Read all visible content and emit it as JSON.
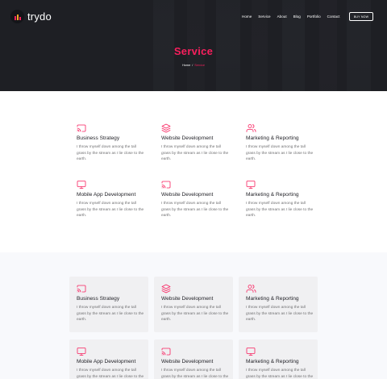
{
  "header": {
    "logo_text": "trydo",
    "nav": [
      "Home",
      "Service",
      "About",
      "Blog",
      "Portfolio",
      "Contact"
    ],
    "buy_now_label": "BUY NOW"
  },
  "hero": {
    "title": "Service",
    "breadcrumb_home": "Home",
    "breadcrumb_separator": "/",
    "breadcrumb_current": "Service"
  },
  "colors": {
    "accent": "#f81f5d",
    "dark": "#1e1f24",
    "text": "#1f1f25",
    "muted": "#717173"
  },
  "services": [
    {
      "icon": "cast-icon",
      "title": "Business Strategy",
      "desc": "I throw myself down among the tall grass by the stream as I lie close to the earth."
    },
    {
      "icon": "layers-icon",
      "title": "Website Development",
      "desc": "I throw myself down among the tall grass by the stream as I lie close to the earth."
    },
    {
      "icon": "users-icon",
      "title": "Marketing & Reporting",
      "desc": "I throw myself down among the tall grass by the stream as I lie close to the earth."
    },
    {
      "icon": "monitor-icon",
      "title": "Mobile App Development",
      "desc": "I throw myself down among the tall grass by the stream as I lie close to the earth."
    },
    {
      "icon": "cast-icon",
      "title": "Website Development",
      "desc": "I throw myself down among the tall grass by the stream as I lie close to the earth."
    },
    {
      "icon": "monitor-icon",
      "title": "Marketing & Reporting",
      "desc": "I throw myself down among the tall grass by the stream as I lie close to the earth."
    }
  ],
  "service_boxes": [
    {
      "icon": "cast-icon",
      "title": "Business Strategy",
      "desc": "I throw myself down among the tall grass by the stream as I lie close to the earth."
    },
    {
      "icon": "layers-icon",
      "title": "Website Development",
      "desc": "I throw myself down among the tall grass by the stream as I lie close to the earth."
    },
    {
      "icon": "users-icon",
      "title": "Marketing & Reporting",
      "desc": "I throw myself down among the tall grass by the stream as I lie close to the earth."
    },
    {
      "icon": "monitor-icon",
      "title": "Mobile App Development",
      "desc": "I throw myself down among the tall grass by the stream as I lie close to the earth."
    },
    {
      "icon": "cast-icon",
      "title": "Website Development",
      "desc": "I throw myself down among the tall grass by the stream as I lie close to the earth."
    },
    {
      "icon": "monitor-icon",
      "title": "Marketing & Reporting",
      "desc": "I throw myself down among the tall grass by the stream as I lie close to the earth."
    }
  ]
}
